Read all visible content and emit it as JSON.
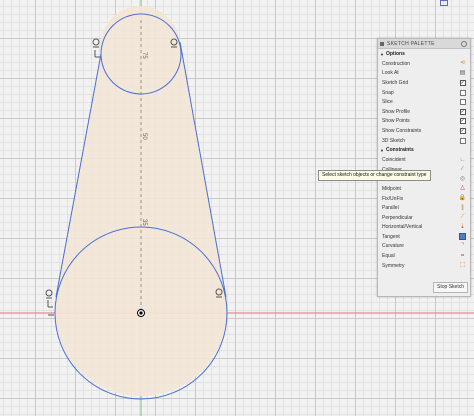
{
  "palette": {
    "title": "SKETCH PALETTE",
    "options_header": "Options",
    "options": [
      {
        "label": "Construction",
        "control": "construction-icon",
        "glyph": "⊲",
        "color": "#d08a2c"
      },
      {
        "label": "Look At",
        "control": "look-at-icon",
        "glyph": "▤",
        "color": "#555555"
      },
      {
        "label": "Sketch Grid",
        "control": "checkbox",
        "checked": true
      },
      {
        "label": "Snap",
        "control": "checkbox",
        "checked": false
      },
      {
        "label": "Slice",
        "control": "checkbox",
        "checked": false
      },
      {
        "label": "Show Profile",
        "control": "checkbox",
        "checked": true
      },
      {
        "label": "Show Points",
        "control": "checkbox",
        "checked": true
      },
      {
        "label": "Show Constraints",
        "control": "checkbox",
        "checked": true
      },
      {
        "label": "3D Sketch",
        "control": "checkbox",
        "checked": false
      }
    ],
    "constraints_header": "Constraints",
    "constraints": [
      {
        "label": "Coincident",
        "icon": "coincident-icon",
        "glyph": "∟",
        "color": "#777777"
      },
      {
        "label": "Collinear",
        "icon": "collinear-icon",
        "glyph": "∕",
        "color": "#777777"
      },
      {
        "label": "Concentric",
        "icon": "concentric-icon",
        "glyph": "◎",
        "color": "#777777"
      },
      {
        "label": "Midpoint",
        "icon": "midpoint-icon",
        "glyph": "△",
        "color": "#c0392b"
      },
      {
        "label": "Fix/UnFix",
        "icon": "lock-icon",
        "glyph": "🔒",
        "color": "#c0392b"
      },
      {
        "label": "Parallel",
        "icon": "parallel-icon",
        "glyph": "∥",
        "color": "#c07a2c"
      },
      {
        "label": "Perpendicular",
        "icon": "perpendicular-icon",
        "glyph": "⟋",
        "color": "#c07a2c"
      },
      {
        "label": "Horizontal/Vertical",
        "icon": "horizontal-vertical-icon",
        "glyph": "⇣",
        "color": "#c0392b"
      },
      {
        "label": "Tangent",
        "icon": "tangent-icon",
        "glyph": "",
        "color": "#4f7fbf"
      },
      {
        "label": "Curvature",
        "icon": "curvature-icon",
        "glyph": "⌝",
        "color": "#c0392b"
      },
      {
        "label": "Equal",
        "icon": "equal-icon",
        "glyph": "=",
        "color": "#c0392b"
      },
      {
        "label": "Symmetry",
        "icon": "symmetry-icon",
        "glyph": "⬚",
        "color": "#c07a2c"
      }
    ],
    "stop_button": "Stop Sketch"
  },
  "tooltip": "Select sketch objects or change constraint type",
  "dimensions": {
    "small_circle": "75",
    "mid_line_upper": "50",
    "mid_line_lower": "35"
  },
  "colors": {
    "profile_fill": "#f3e6d6",
    "sketch_line": "#4a6fd4",
    "axis_red": "#e05a5a",
    "axis_green": "#5aa85a"
  }
}
